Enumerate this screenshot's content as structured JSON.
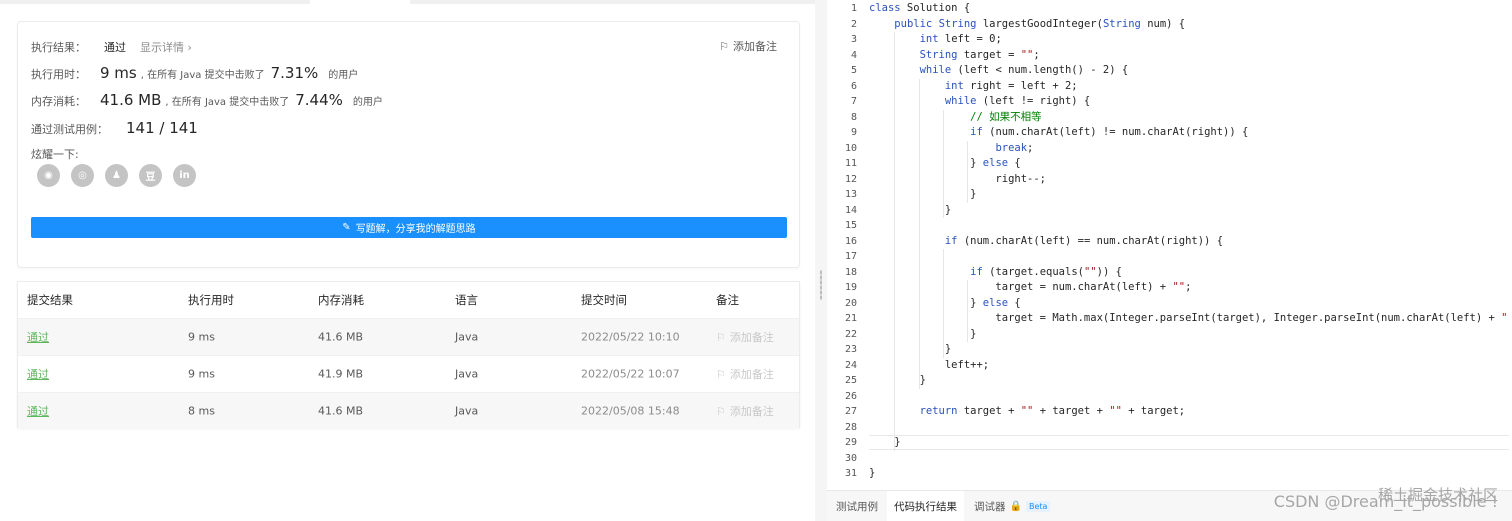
{
  "result_card": {
    "result_label": "执行结果：",
    "result_status": "通过",
    "detail_link": "显示详情 ›",
    "add_note": "添加备注",
    "runtime_label": "执行用时：",
    "runtime_value": "9 ms",
    "runtime_text1": ", 在所有 Java 提交中击败了",
    "runtime_pct": "7.31%",
    "runtime_text2": "的用户",
    "memory_label": "内存消耗：",
    "memory_value": "41.6 MB",
    "memory_text1": ", 在所有 Java 提交中击败了",
    "memory_pct": "7.44%",
    "memory_text2": "的用户",
    "tests_label": "通过测试用例：",
    "tests_value": "141 / 141",
    "share_label": "炫耀一下:",
    "share_icons": [
      {
        "name": "wechat-icon",
        "glyph": "◉"
      },
      {
        "name": "weibo-icon",
        "glyph": "◎"
      },
      {
        "name": "qq-icon",
        "glyph": "♟"
      },
      {
        "name": "douban-icon",
        "glyph": "豆"
      },
      {
        "name": "linkedin-icon",
        "glyph": "in"
      }
    ],
    "write_button": "写题解，分享我的解题思路"
  },
  "submissions": {
    "headers": [
      "提交结果",
      "执行用时",
      "内存消耗",
      "语言",
      "提交时间",
      "备注"
    ],
    "rows": [
      {
        "result": "通过",
        "runtime": "9 ms",
        "memory": "41.6 MB",
        "lang": "Java",
        "time": "2022/05/22 10:10",
        "note": "添加备注"
      },
      {
        "result": "通过",
        "runtime": "9 ms",
        "memory": "41.9 MB",
        "lang": "Java",
        "time": "2022/05/22 10:07",
        "note": "添加备注"
      },
      {
        "result": "通过",
        "runtime": "8 ms",
        "memory": "41.6 MB",
        "lang": "Java",
        "time": "2022/05/08 15:48",
        "note": "添加备注"
      }
    ]
  },
  "editor": {
    "lines": [
      "class Solution {",
      "    public String largestGoodInteger(String num) {",
      "        int left = 0;",
      "        String target = \"\";",
      "        while (left < num.length() - 2) {",
      "            int right = left + 2;",
      "            while (left != right) {",
      "                // 如果不相等",
      "                if (num.charAt(left) != num.charAt(right)) {",
      "                    break;",
      "                } else {",
      "                    right--;",
      "                }",
      "            }",
      "",
      "            if (num.charAt(left) == num.charAt(right)) {",
      "",
      "                if (target.equals(\"\")) {",
      "                    target = num.charAt(left) + \"\";",
      "                } else {",
      "                    target = Math.max(Integer.parseInt(target), Integer.parseInt(num.charAt(left) + \"\"));",
      "                }",
      "            }",
      "            left++;",
      "        }",
      "",
      "        return target + \"\" + target + \"\" + target;",
      "",
      "    }",
      "",
      "}"
    ]
  },
  "bottom_tabs": {
    "testcase": "测试用例",
    "result": "代码执行结果",
    "debugger": "调试器",
    "beta": "Beta"
  },
  "watermark": "CSDN @Dream_it_possible !",
  "watermark2": "稀土掘金技术社区"
}
